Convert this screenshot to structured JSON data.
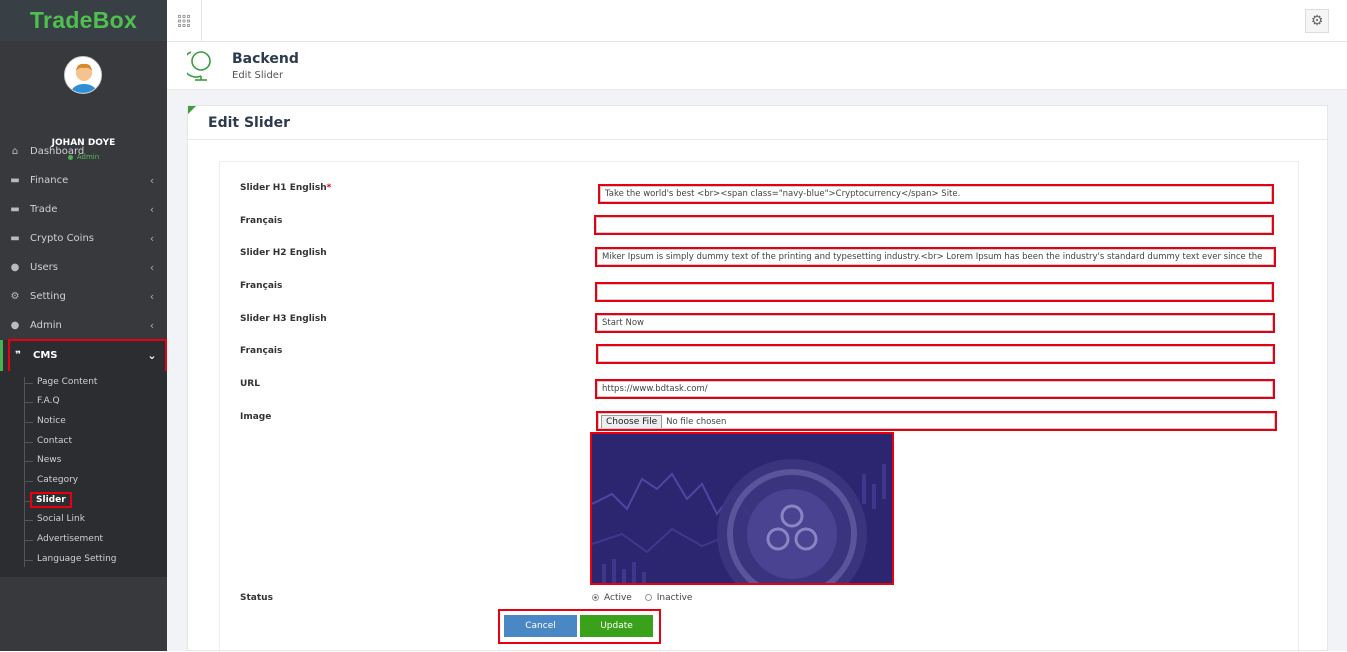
{
  "brand": "TradeBox",
  "user": {
    "name": "JOHAN DOYE",
    "role": "Admin"
  },
  "sidebar": {
    "items": [
      {
        "label": "Dashboard",
        "icon": "home-icon",
        "chevron": false
      },
      {
        "label": "Finance",
        "icon": "card-icon",
        "chevron": true
      },
      {
        "label": "Trade",
        "icon": "card-icon",
        "chevron": true
      },
      {
        "label": "Crypto Coins",
        "icon": "card-icon",
        "chevron": true
      },
      {
        "label": "Users",
        "icon": "users-icon",
        "chevron": true
      },
      {
        "label": "Setting",
        "icon": "gear-icon",
        "chevron": true
      },
      {
        "label": "Admin",
        "icon": "users-icon",
        "chevron": true
      },
      {
        "label": "CMS",
        "icon": "comments-icon",
        "chevron": true,
        "expanded": true
      }
    ],
    "cms_submenu": [
      "Page Content",
      "F.A.Q",
      "Notice",
      "Contact",
      "News",
      "Category",
      "Slider",
      "Social Link",
      "Advertisement",
      "Language Setting"
    ],
    "active_sub": "Slider"
  },
  "header": {
    "title": "Backend",
    "subtitle": "Edit Slider"
  },
  "panel": {
    "title": "Edit Slider"
  },
  "form": {
    "h1_en_label": "Slider H1 English",
    "h1_en_value": "Take the world's  best <br><span class=\"navy-blue\">Cryptocurrency</span>  Site.",
    "h1_fr_label": "Français",
    "h1_fr_value": "",
    "h2_en_label": "Slider H2 English",
    "h2_en_value": "Miker Ipsum is simply dummy text of the printing and typesetting industry.<br> Lorem Ipsum has been the industry's standard dummy text ever since the",
    "h2_fr_label": "Français",
    "h2_fr_value": "",
    "h3_en_label": "Slider H3 English",
    "h3_en_value": "Start Now",
    "h3_fr_label": "Français",
    "h3_fr_value": "",
    "url_label": "URL",
    "url_value": "https://www.bdtask.com/",
    "image_label": "Image",
    "file_button": "Choose File",
    "file_status": "No file chosen",
    "status_label": "Status",
    "status_active": "Active",
    "status_inactive": "Inactive",
    "status_selected": "Active"
  },
  "buttons": {
    "cancel": "Cancel",
    "update": "Update"
  },
  "colors": {
    "brand": "#4fc04f",
    "sidebar": "#37393c",
    "highlight": "#e60012",
    "cancel": "#4a87c5",
    "update": "#3aa21a"
  }
}
